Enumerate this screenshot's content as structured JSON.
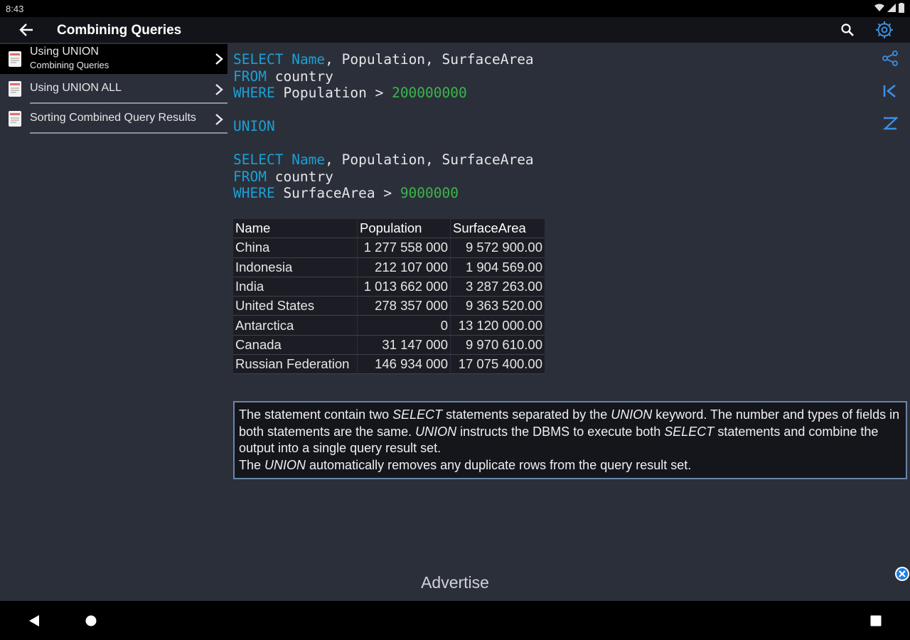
{
  "status": {
    "time": "8:43"
  },
  "appbar": {
    "title": "Combining Queries"
  },
  "sidebar": {
    "items": [
      {
        "label": "Using UNION",
        "sublabel": "Combining Queries"
      },
      {
        "label": "Using UNION ALL"
      },
      {
        "label": "Sorting Combined Query Results"
      }
    ]
  },
  "code": {
    "select_kw": "SELECT",
    "name_col": "Name",
    "cols_rest": ", Population, SurfaceArea",
    "from_kw": "FROM",
    "table": " country",
    "where_kw": "WHERE",
    "cond1": " Population > ",
    "num1": "200000000",
    "union_kw": "UNION",
    "cond2": " SurfaceArea > ",
    "num2": "9000000"
  },
  "table": {
    "headers": [
      "Name",
      "Population",
      "SurfaceArea"
    ],
    "rows": [
      [
        "China",
        "1 277 558 000",
        "9 572 900.00"
      ],
      [
        "Indonesia",
        "212 107 000",
        "1 904 569.00"
      ],
      [
        "India",
        "1 013 662 000",
        "3 287 263.00"
      ],
      [
        "United States",
        "278 357 000",
        "9 363 520.00"
      ],
      [
        "Antarctica",
        "0",
        "13 120 000.00"
      ],
      [
        "Canada",
        "31 147 000",
        "9 970 610.00"
      ],
      [
        "Russian Federation",
        "146 934 000",
        "17 075 400.00"
      ]
    ]
  },
  "description": {
    "p1": "The statement contain two ",
    "p1_i": "SELECT",
    "p2": " statements separated by the ",
    "p2_i": "UNION",
    "p3": " keyword. The number and types of fields in both statements are the same. ",
    "p3_i": "UNION",
    "p4": " instructs the DBMS to execute both ",
    "p4_i": "SELECT",
    "p5": " statements and combine the output into a single query result set.",
    "p6": "The ",
    "p6_i": "UNION",
    "p7": " automatically removes any duplicate rows from the query result set."
  },
  "ad": {
    "label": "Advertise"
  },
  "colors": {
    "keyword": "#1aa1d4",
    "number": "#3ab54a",
    "accent": "#3d8fe0"
  }
}
